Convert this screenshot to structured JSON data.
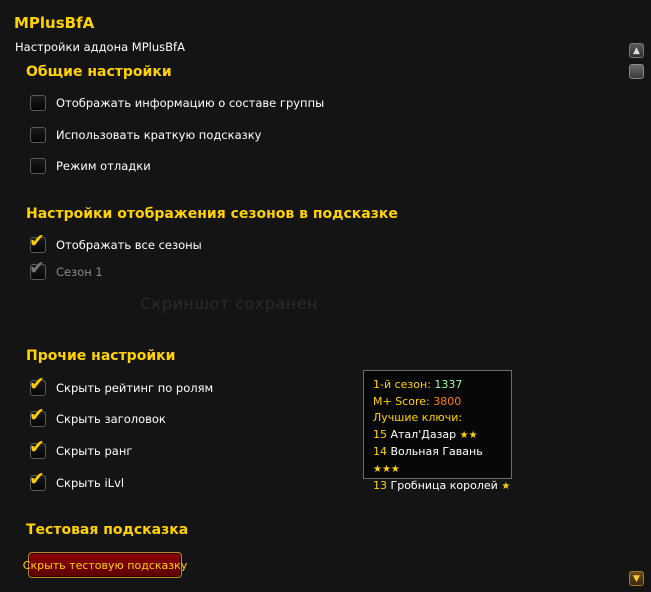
{
  "addon_title": "MPlusBfA",
  "subtitle": "Настройки аддона MPlusBfA",
  "ghost_text": "Скриншот сохранен",
  "sections": {
    "general": {
      "header": "Общие настройки",
      "options": [
        {
          "label": "Отображать информацию о составе группы",
          "checked": false
        },
        {
          "label": "Использовать краткую подсказку",
          "checked": false
        },
        {
          "label": "Режим отладки",
          "checked": false
        }
      ]
    },
    "seasons": {
      "header": "Настройки отображения сезонов в подсказке",
      "options": [
        {
          "label": "Отображать все сезоны",
          "checked": true
        },
        {
          "label": "Сезон 1",
          "checked": true,
          "disabled": true
        }
      ]
    },
    "other": {
      "header": "Прочие настройки",
      "options": [
        {
          "label": "Скрыть рейтинг по ролям",
          "checked": true
        },
        {
          "label": "Скрыть заголовок",
          "checked": true
        },
        {
          "label": "Скрыть ранг",
          "checked": true
        },
        {
          "label": "Скрыть iLvl",
          "checked": true
        }
      ]
    },
    "test": {
      "header": "Тестовая подсказка",
      "button_label": "Скрыть тестовую подсказку"
    }
  },
  "tooltip": {
    "season_key": "1-й сезон:",
    "season_value": "1337",
    "score_key": "M+ Score:",
    "score_value": "3800",
    "best_keys_label": "Лучшие ключи:",
    "keys": [
      {
        "level": "15",
        "dungeon": "Атал'Дазар",
        "stars": "★★"
      },
      {
        "level": "14",
        "dungeon": "Вольная Гавань",
        "stars": "★★★"
      },
      {
        "level": "13",
        "dungeon": "Гробница королей",
        "stars": "★"
      }
    ]
  },
  "icons": {
    "check": "✔",
    "scroll_up": "▲",
    "scroll_down": "▼"
  },
  "colors": {
    "gold": "#ffd200",
    "button_red": "#8e0000",
    "score_orange": "#ff8000",
    "season_green": "#9cff9c"
  }
}
